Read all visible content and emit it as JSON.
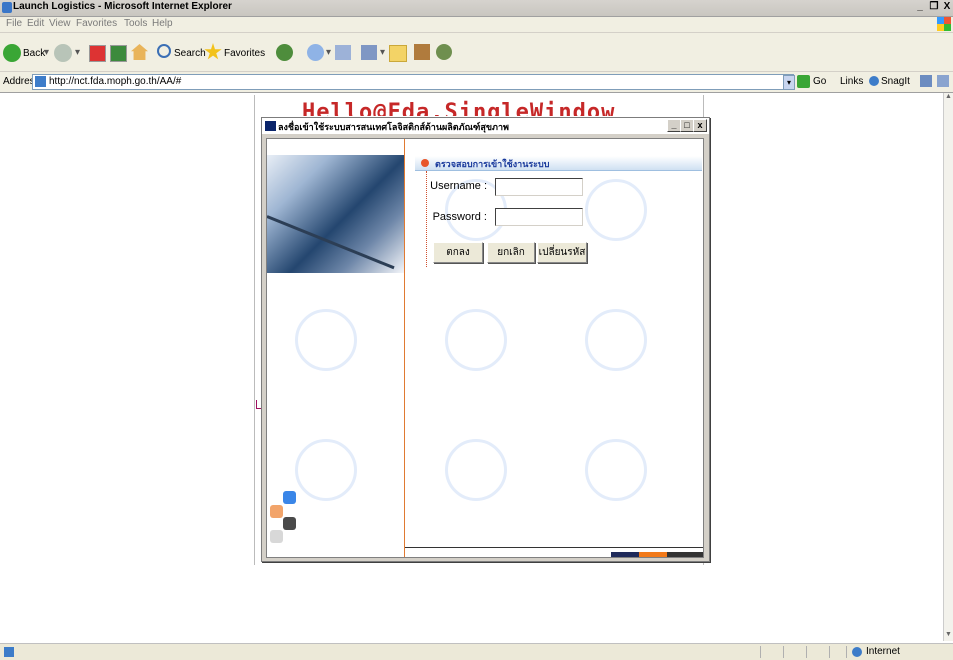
{
  "window": {
    "title": "Launch Logistics - Microsoft Internet Explorer",
    "controls": [
      "_",
      "❐",
      "X"
    ]
  },
  "menu": [
    "File",
    "Edit",
    "View",
    "Favorites",
    "Tools",
    "Help"
  ],
  "toolbar": {
    "back_label": "Back",
    "search_label": "Search",
    "favorites_label": "Favorites"
  },
  "address": {
    "label": "Address",
    "url": "http://nct.fda.moph.go.th/AA/#",
    "go_label": "Go",
    "links_label": "Links",
    "snagit_label": "SnagIt"
  },
  "page": {
    "header_text": "Hello@Fda.SingleWindow"
  },
  "dialog": {
    "title": "ลงชื่อเข้าใช้ระบบสารสนเทศโลจิสติกส์ด้านผลิตภัณฑ์สุขภาพ",
    "controls": [
      "_",
      "□",
      "x"
    ],
    "section_title": "ตรวจสอบการเข้าใช้งานระบบ",
    "username_label": "Username :",
    "password_label": "Password :",
    "username_value": "",
    "password_value": "",
    "ok_button": "ตกลง",
    "cancel_button": "ยกเลิก",
    "change_password_button": "เปลี่ยนรหัส"
  },
  "status": {
    "zone": "Internet"
  },
  "colors": {
    "accent_orange": "#e07a32",
    "dialog_title_blue": "#0a246a",
    "section_text": "#1a3a9c",
    "header_red": "#c62828"
  }
}
